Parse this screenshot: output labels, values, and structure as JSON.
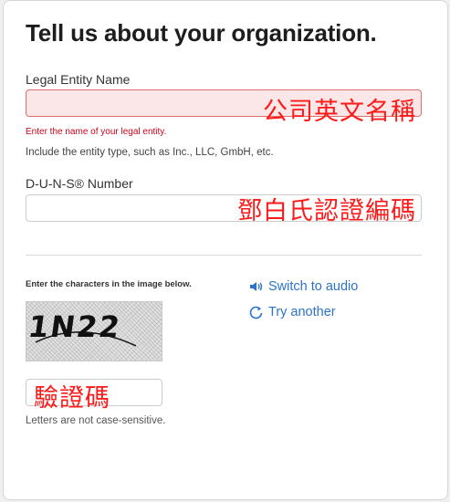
{
  "page": {
    "title": "Tell us about your organization."
  },
  "legal_entity": {
    "label": "Legal Entity Name",
    "overlay_text": "公司英文名稱",
    "error": "Enter the name of your legal entity.",
    "hint": "Include the entity type, such as Inc., LLC, GmbH, etc."
  },
  "duns": {
    "label": "D-U-N-S® Number",
    "overlay_text": "鄧白氏認證編碼"
  },
  "captcha": {
    "instruction": "Enter the characters in the image below.",
    "image_text": "1N22",
    "switch_audio": "Switch to audio",
    "try_another": "Try another",
    "overlay_text": "驗證碼",
    "case_note": "Letters are not case-sensitive."
  },
  "colors": {
    "link": "#2b73c9",
    "error": "#d0021b",
    "annotation": "#ff1a1a"
  },
  "icons": {
    "audio": "speaker-icon",
    "refresh": "refresh-icon"
  }
}
